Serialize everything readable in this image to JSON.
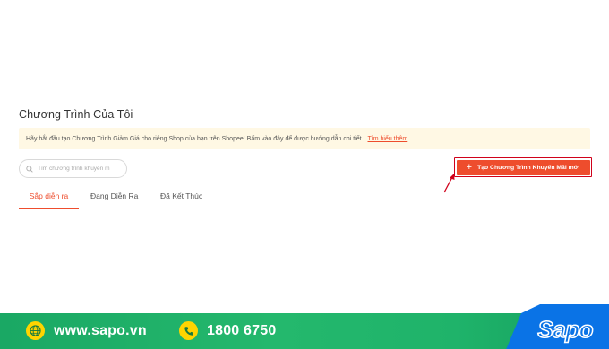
{
  "page": {
    "title": "Chương Trình Của Tôi"
  },
  "banner": {
    "text": "Hãy bắt đầu tạo Chương Trình Giảm Giá cho riêng Shop của bạn trên Shopee! Bấm vào đây để được hướng dẫn chi tiết.",
    "link": "Tìm hiểu thêm"
  },
  "search": {
    "placeholder": "Tìm chương trình khuyến m"
  },
  "create_button": {
    "icon": "plus-icon",
    "label": "Tạo Chương Trình Khuyến Mãi mới"
  },
  "tabs": [
    {
      "label": "Sắp diễn ra",
      "active": true
    },
    {
      "label": "Đang Diễn Ra",
      "active": false
    },
    {
      "label": "Đã Kết Thúc",
      "active": false
    }
  ],
  "footer": {
    "website": "www.sapo.vn",
    "phone": "1800 6750",
    "brand": "Sapo"
  },
  "colors": {
    "accent": "#ee4d2d",
    "highlight_border": "#d0011b",
    "banner_bg": "#fff8e4",
    "footer_green": "#1fb36a",
    "brand_blue": "#0a73e6",
    "icon_yellow": "#ffd400"
  }
}
